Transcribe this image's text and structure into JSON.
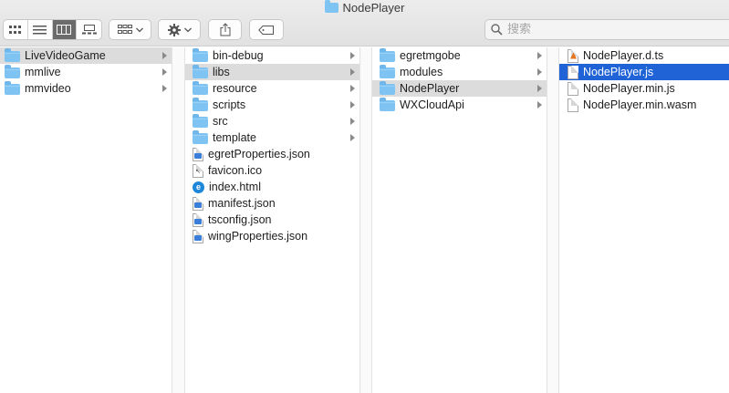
{
  "window": {
    "title": "NodePlayer"
  },
  "toolbar": {
    "view_buttons": [
      {
        "name": "icon-view-button",
        "icon": "grid-icon",
        "active": false
      },
      {
        "name": "list-view-button",
        "icon": "list-icon",
        "active": false
      },
      {
        "name": "column-view-button",
        "icon": "columns-icon",
        "active": true
      },
      {
        "name": "gallery-view-button",
        "icon": "gallery-icon",
        "active": false
      }
    ],
    "search": {
      "placeholder": "搜索",
      "value": ""
    }
  },
  "columns": [
    {
      "items": [
        {
          "label": "LiveVideoGame",
          "type": "folder",
          "state": "path-selected",
          "has_children": true
        },
        {
          "label": "mmlive",
          "type": "folder",
          "state": "",
          "has_children": true
        },
        {
          "label": "mmvideo",
          "type": "folder",
          "state": "",
          "has_children": true
        }
      ]
    },
    {
      "items": [
        {
          "label": "bin-debug",
          "type": "folder",
          "state": "",
          "has_children": true
        },
        {
          "label": "libs",
          "type": "folder",
          "state": "path-selected",
          "has_children": true
        },
        {
          "label": "resource",
          "type": "folder",
          "state": "",
          "has_children": true
        },
        {
          "label": "scripts",
          "type": "folder",
          "state": "",
          "has_children": true
        },
        {
          "label": "src",
          "type": "folder",
          "state": "",
          "has_children": true
        },
        {
          "label": "template",
          "type": "folder",
          "state": "",
          "has_children": true
        },
        {
          "label": "egretProperties.json",
          "type": "json",
          "state": "",
          "has_children": false
        },
        {
          "label": "favicon.ico",
          "type": "ico",
          "state": "",
          "has_children": false
        },
        {
          "label": "index.html",
          "type": "html",
          "state": "",
          "has_children": false
        },
        {
          "label": "manifest.json",
          "type": "json",
          "state": "",
          "has_children": false
        },
        {
          "label": "tsconfig.json",
          "type": "json",
          "state": "",
          "has_children": false
        },
        {
          "label": "wingProperties.json",
          "type": "json",
          "state": "",
          "has_children": false
        }
      ]
    },
    {
      "items": [
        {
          "label": "egretmgobe",
          "type": "folder",
          "state": "",
          "has_children": true
        },
        {
          "label": "modules",
          "type": "folder",
          "state": "",
          "has_children": true
        },
        {
          "label": "NodePlayer",
          "type": "folder",
          "state": "path-selected",
          "has_children": true
        },
        {
          "label": "WXCloudApi",
          "type": "folder",
          "state": "",
          "has_children": true
        }
      ]
    },
    {
      "items": [
        {
          "label": "NodePlayer.d.ts",
          "type": "ts",
          "state": "",
          "has_children": false
        },
        {
          "label": "NodePlayer.js",
          "type": "doc",
          "state": "selected",
          "has_children": false
        },
        {
          "label": "NodePlayer.min.js",
          "type": "doc",
          "state": "",
          "has_children": false
        },
        {
          "label": "NodePlayer.min.wasm",
          "type": "doc",
          "state": "",
          "has_children": false
        }
      ]
    }
  ],
  "colors": {
    "selection": "#2063d7",
    "path_selection": "#dcdcdc",
    "folder": "#7ec3f2"
  }
}
